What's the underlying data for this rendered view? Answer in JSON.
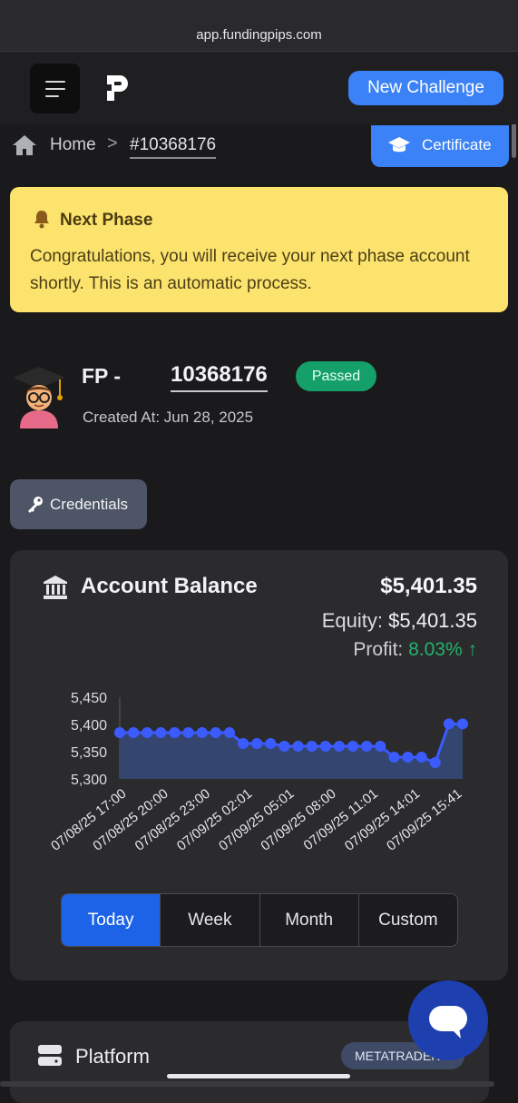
{
  "browser": {
    "url": "app.fundingpips.com"
  },
  "header": {
    "new_challenge_label": "New Challenge"
  },
  "breadcrumb": {
    "home": "Home",
    "separator": ">",
    "current": "#10368176",
    "certificate_label": "Certificate"
  },
  "alert": {
    "title": "Next Phase",
    "message": "Congratulations, you will receive your next phase account shortly. This is an automatic process."
  },
  "account": {
    "prefix": "FP -",
    "number": "10368176",
    "status": "Passed",
    "created": "Created At: Jun 28, 2025",
    "credentials_label": "Credentials"
  },
  "balance_card": {
    "title": "Account Balance",
    "balance": "$5,401.35",
    "equity_label": "Equity:",
    "equity_value": "$5,401.35",
    "profit_label": "Profit:",
    "profit_value": "8.03%",
    "profit_arrow": "↑",
    "accent": "#3b5bff",
    "profit_color": "#22b26b"
  },
  "chart_data": {
    "type": "area",
    "y_ticks": [
      "5,450",
      "5,400",
      "5,350",
      "5,300"
    ],
    "ylim": [
      5300,
      5450
    ],
    "x_ticks": [
      "07/08/25 17:00",
      "07/08/25 20:00",
      "07/08/25 23:00",
      "07/09/25 02:01",
      "07/09/25 05:01",
      "07/09/25 08:00",
      "07/09/25 11:01",
      "07/09/25 14:01",
      "07/09/25 15:41"
    ],
    "values": [
      5385,
      5385,
      5385,
      5385,
      5385,
      5385,
      5385,
      5385,
      5385,
      5365,
      5365,
      5365,
      5360,
      5360,
      5360,
      5360,
      5360,
      5360,
      5360,
      5360,
      5340,
      5340,
      5340,
      5330,
      5401,
      5401
    ]
  },
  "range_tabs": [
    "Today",
    "Week",
    "Month",
    "Custom"
  ],
  "platform": {
    "title": "Platform",
    "badge": "METATRADER 5"
  }
}
